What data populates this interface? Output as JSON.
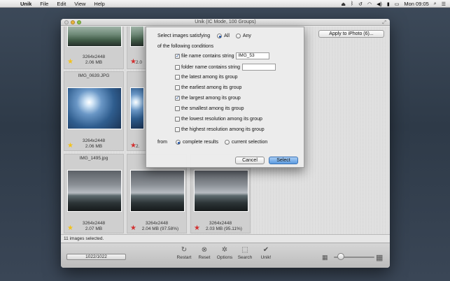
{
  "menubar": {
    "app_name": "Unik",
    "items": [
      "File",
      "Edit",
      "View",
      "Help"
    ],
    "clock": "Mon 09:05"
  },
  "window": {
    "title": "Unik (IC Mode, 100 Groups)",
    "apply_button": "Apply to iPhoto (6)..."
  },
  "cards": [
    {
      "fname": "",
      "res": "3264x2448",
      "size": "2.06 MB",
      "star": "yellow"
    },
    {
      "fname": "",
      "res": "",
      "size": "2.0",
      "star": "red"
    },
    {
      "fname": "IMG_0639.JPG",
      "res": "3264x2448",
      "size": "2.06 MB",
      "star": "yellow"
    },
    {
      "fname": "",
      "res": "",
      "size": "2.",
      "star": "red"
    },
    {
      "fname": "IMG_1495.jpg",
      "res": "3264x2448",
      "size": "2.07 MB",
      "star": "yellow"
    },
    {
      "fname": "",
      "res": "3264x2448",
      "size": "2.04 MB (97.58%)",
      "star": "red"
    },
    {
      "fname": "",
      "res": "3264x2448",
      "size": "2.03 MB (95.11%)",
      "star": "red"
    }
  ],
  "status": "11 images selected.",
  "toolbar": {
    "progress": "1022/1022",
    "tools": [
      "Restart",
      "Reset",
      "Options",
      "Search",
      "Unik!"
    ]
  },
  "sheet": {
    "select_label": "Select images satisfying",
    "radio_all": "All",
    "radio_any": "Any",
    "following": "of the following conditions",
    "conditions": [
      {
        "label": "file name contains string",
        "checked": true,
        "value": "IMG_53"
      },
      {
        "label": "folder name contains string",
        "checked": false,
        "value": ""
      },
      {
        "label": "the latest among its group",
        "checked": false
      },
      {
        "label": "the earliest among its group",
        "checked": false
      },
      {
        "label": "the largest among its group",
        "checked": true
      },
      {
        "label": "the smallest among its group",
        "checked": false
      },
      {
        "label": "the lowest resolution among its group",
        "checked": false
      },
      {
        "label": "the highest resolution among its group",
        "checked": false
      }
    ],
    "from_label": "from",
    "from_complete": "complete results",
    "from_current": "current selection",
    "cancel": "Cancel",
    "select": "Select"
  }
}
